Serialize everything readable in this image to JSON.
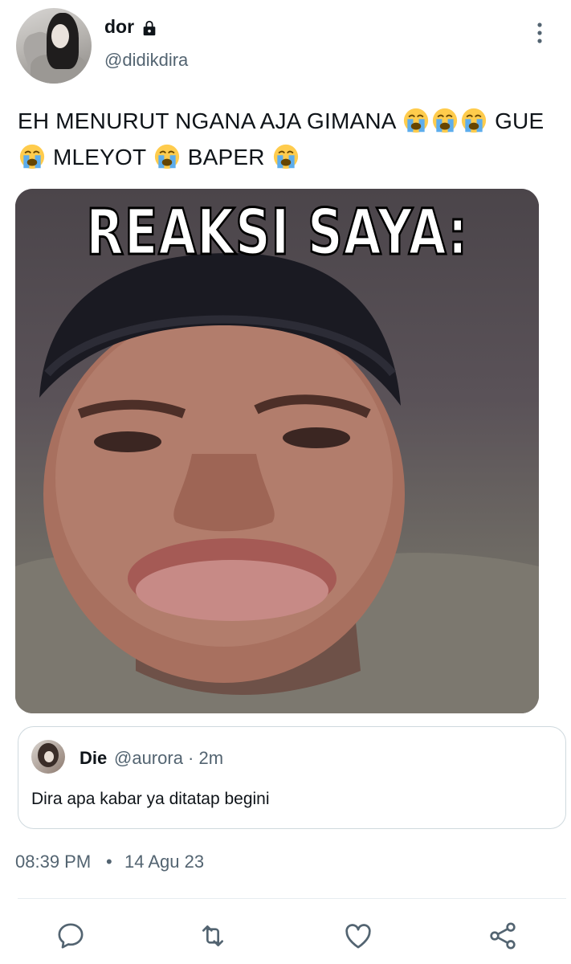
{
  "author": {
    "display_name": "dor",
    "handle": "@didikdira",
    "avatar_icon": "user-avatar",
    "protected_icon": "lock-icon"
  },
  "tweet": {
    "text_line1": "EH MENURUT NGANA AJA GIMANA",
    "text_line1_end": "GUE",
    "text_line2_a": "MLEYOT",
    "text_line2_b": "BAPER",
    "emoji": "loudly-crying-face"
  },
  "media": {
    "caption": "REAKSI SAYA:"
  },
  "quote": {
    "name": "Die",
    "meta": "@aurora · 2m",
    "text": "Dira apa kabar ya ditatap begini"
  },
  "meta": {
    "time": "08:39 PM",
    "separator": "•",
    "date": "14 Agu 23"
  },
  "actions": [
    {
      "name": "reply-icon"
    },
    {
      "name": "retweet-icon"
    },
    {
      "name": "like-icon"
    },
    {
      "name": "share-icon"
    }
  ],
  "colors": {
    "text_primary": "#0f1419",
    "text_secondary": "#536471",
    "border": "#cfd9de"
  }
}
